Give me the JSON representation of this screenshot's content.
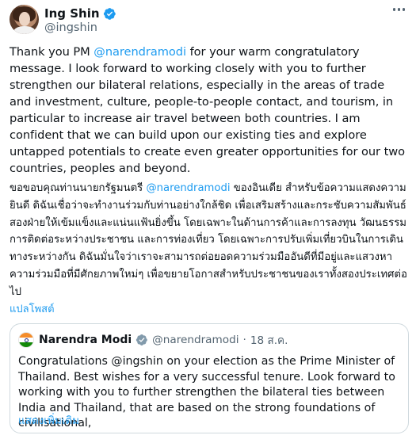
{
  "author": {
    "display_name": "Ing Shin",
    "handle": "@ingshin"
  },
  "post": {
    "en_before": "Thank you PM ",
    "en_mention": "@narendramodi",
    "en_after": " for your warm congratulatory message. I look forward to working closely with you to further strengthen our bilateral relations, especially in the areas of trade and investment, culture, people-to-people contact, and tourism, in particular to increase air travel between both countries. I am confident that we can build upon our existing ties and explore untapped potentials to create even greater opportunities for our two countries, peoples and beyond.",
    "th_before": "ขอขอบคุณท่านนายกรัฐมนตรี ",
    "th_mention": "@narendramodi",
    "th_after": " ของอินเดีย สำหรับข้อความแสดงความยินดี ดิฉันเชื่อว่าจะทำงานร่วมกับท่านอย่างใกล้ชิด เพื่อเสริมสร้างและกระชับความสัมพันธ์สองฝ่ายให้เข้มแข็งและแน่นแฟ้นยิ่งขึ้น โดยเฉพาะในด้านการค้าและการลงทุน วัฒนธรรม การติดต่อระหว่างประชาชน และการท่องเที่ยว โดยเฉพาะการปรับเพิ่มเที่ยวบินในการเดินทางระหว่างกัน ดิฉันมั่นใจว่าเราจะสามารถต่อยอดความร่วมมืออันดีที่มีอยู่และแสวงหาความร่วมมือที่มีศักยภาพใหม่ๆ เพื่อขยายโอกาสสำหรับประชาชนของเราทั้งสองประเทศต่อไป",
    "translate_label": "แปลโพสต์"
  },
  "quoted": {
    "display_name": "Narendra Modi",
    "handle": "@narendramodi",
    "separator": "·",
    "date": "18 ส.ค.",
    "text": "Congratulations @ingshin on your election as the Prime Minister of Thailand. Best wishes for a very successful tenure. Look forward to working with you to further strengthen the bilateral ties between India and Thailand, that are based on the strong foundations of civilisational,",
    "show_more_label": "แสดงเพิ่มเติม"
  },
  "icons": {
    "verified": "verified-badge-icon",
    "more": "more-options-icon"
  },
  "colors": {
    "accent": "#1d9bf0",
    "text": "#0f1419",
    "secondary": "#536471",
    "border": "#cfd9de"
  }
}
